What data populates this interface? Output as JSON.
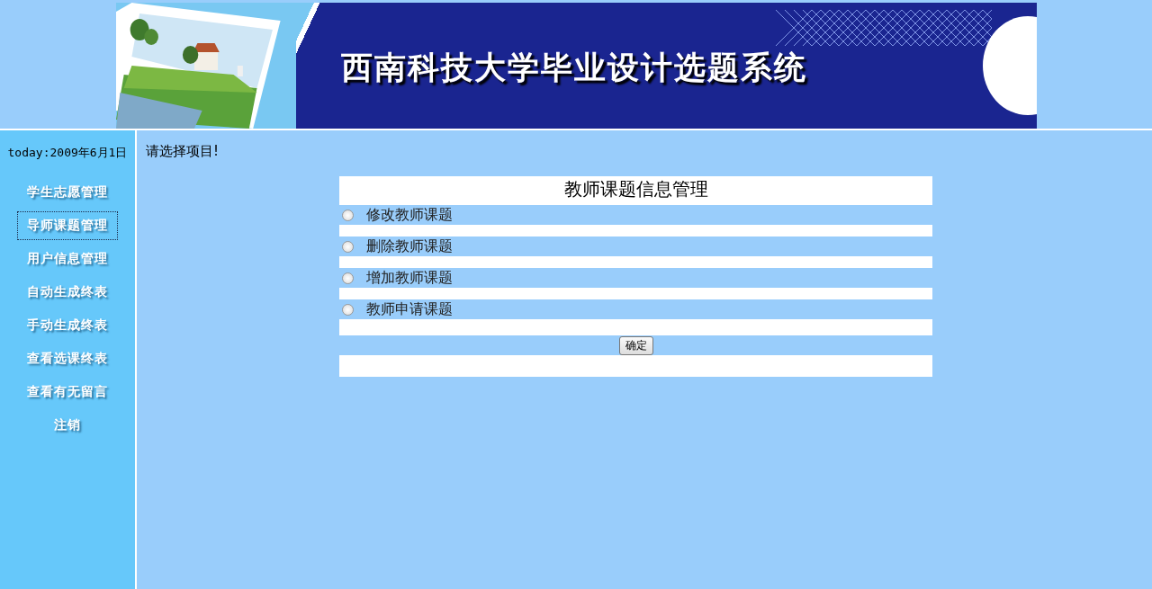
{
  "banner": {
    "title": "西南科技大学毕业设计选题系统"
  },
  "sidebar": {
    "today": "today:2009年6月1日",
    "items": [
      {
        "label": "学生志愿管理",
        "selected": false
      },
      {
        "label": "导师课题管理",
        "selected": true
      },
      {
        "label": "用户信息管理",
        "selected": false
      },
      {
        "label": "自动生成终表",
        "selected": false
      },
      {
        "label": "手动生成终表",
        "selected": false
      },
      {
        "label": "查看选课终表",
        "selected": false
      },
      {
        "label": "查看有无留言",
        "selected": false
      },
      {
        "label": "注销",
        "selected": false
      }
    ]
  },
  "prompt": "请选择项目!",
  "form": {
    "title": "教师课题信息管理",
    "options": [
      {
        "label": "修改教师课题",
        "checked": false
      },
      {
        "label": "删除教师课题",
        "checked": false
      },
      {
        "label": "增加教师课题",
        "checked": false
      },
      {
        "label": "教师申请课题",
        "checked": false
      }
    ],
    "submit": "确定"
  }
}
